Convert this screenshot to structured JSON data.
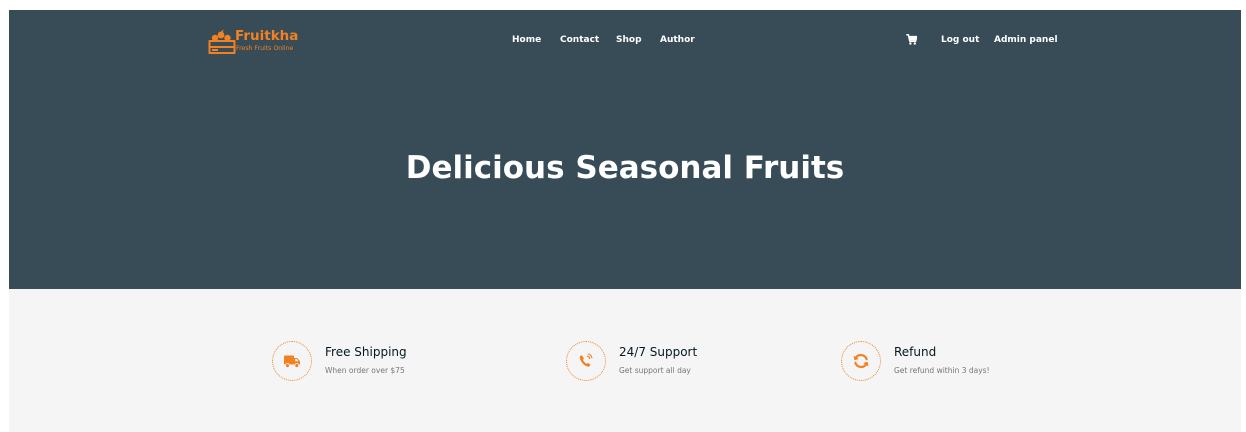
{
  "brand": {
    "name": "Fruitkha",
    "tagline": "Fresh Fruits Online",
    "logo_icon": "fruit-crate-icon",
    "accent_color": "#f28123"
  },
  "nav": {
    "links": [
      "Home",
      "Contact",
      "Shop",
      "Author"
    ],
    "cart_icon": "shopping-cart-icon",
    "account_links": [
      "Log out",
      "Admin panel"
    ]
  },
  "hero": {
    "title": "Delicious Seasonal Fruits",
    "background_color": "#384c57"
  },
  "features": [
    {
      "icon": "shipping-truck-icon",
      "title": "Free Shipping",
      "description": "When order over $75"
    },
    {
      "icon": "phone-support-icon",
      "title": "24/7 Support",
      "description": "Get support all day"
    },
    {
      "icon": "refund-sync-icon",
      "title": "Refund",
      "description": "Get refund within 3 days!"
    }
  ]
}
